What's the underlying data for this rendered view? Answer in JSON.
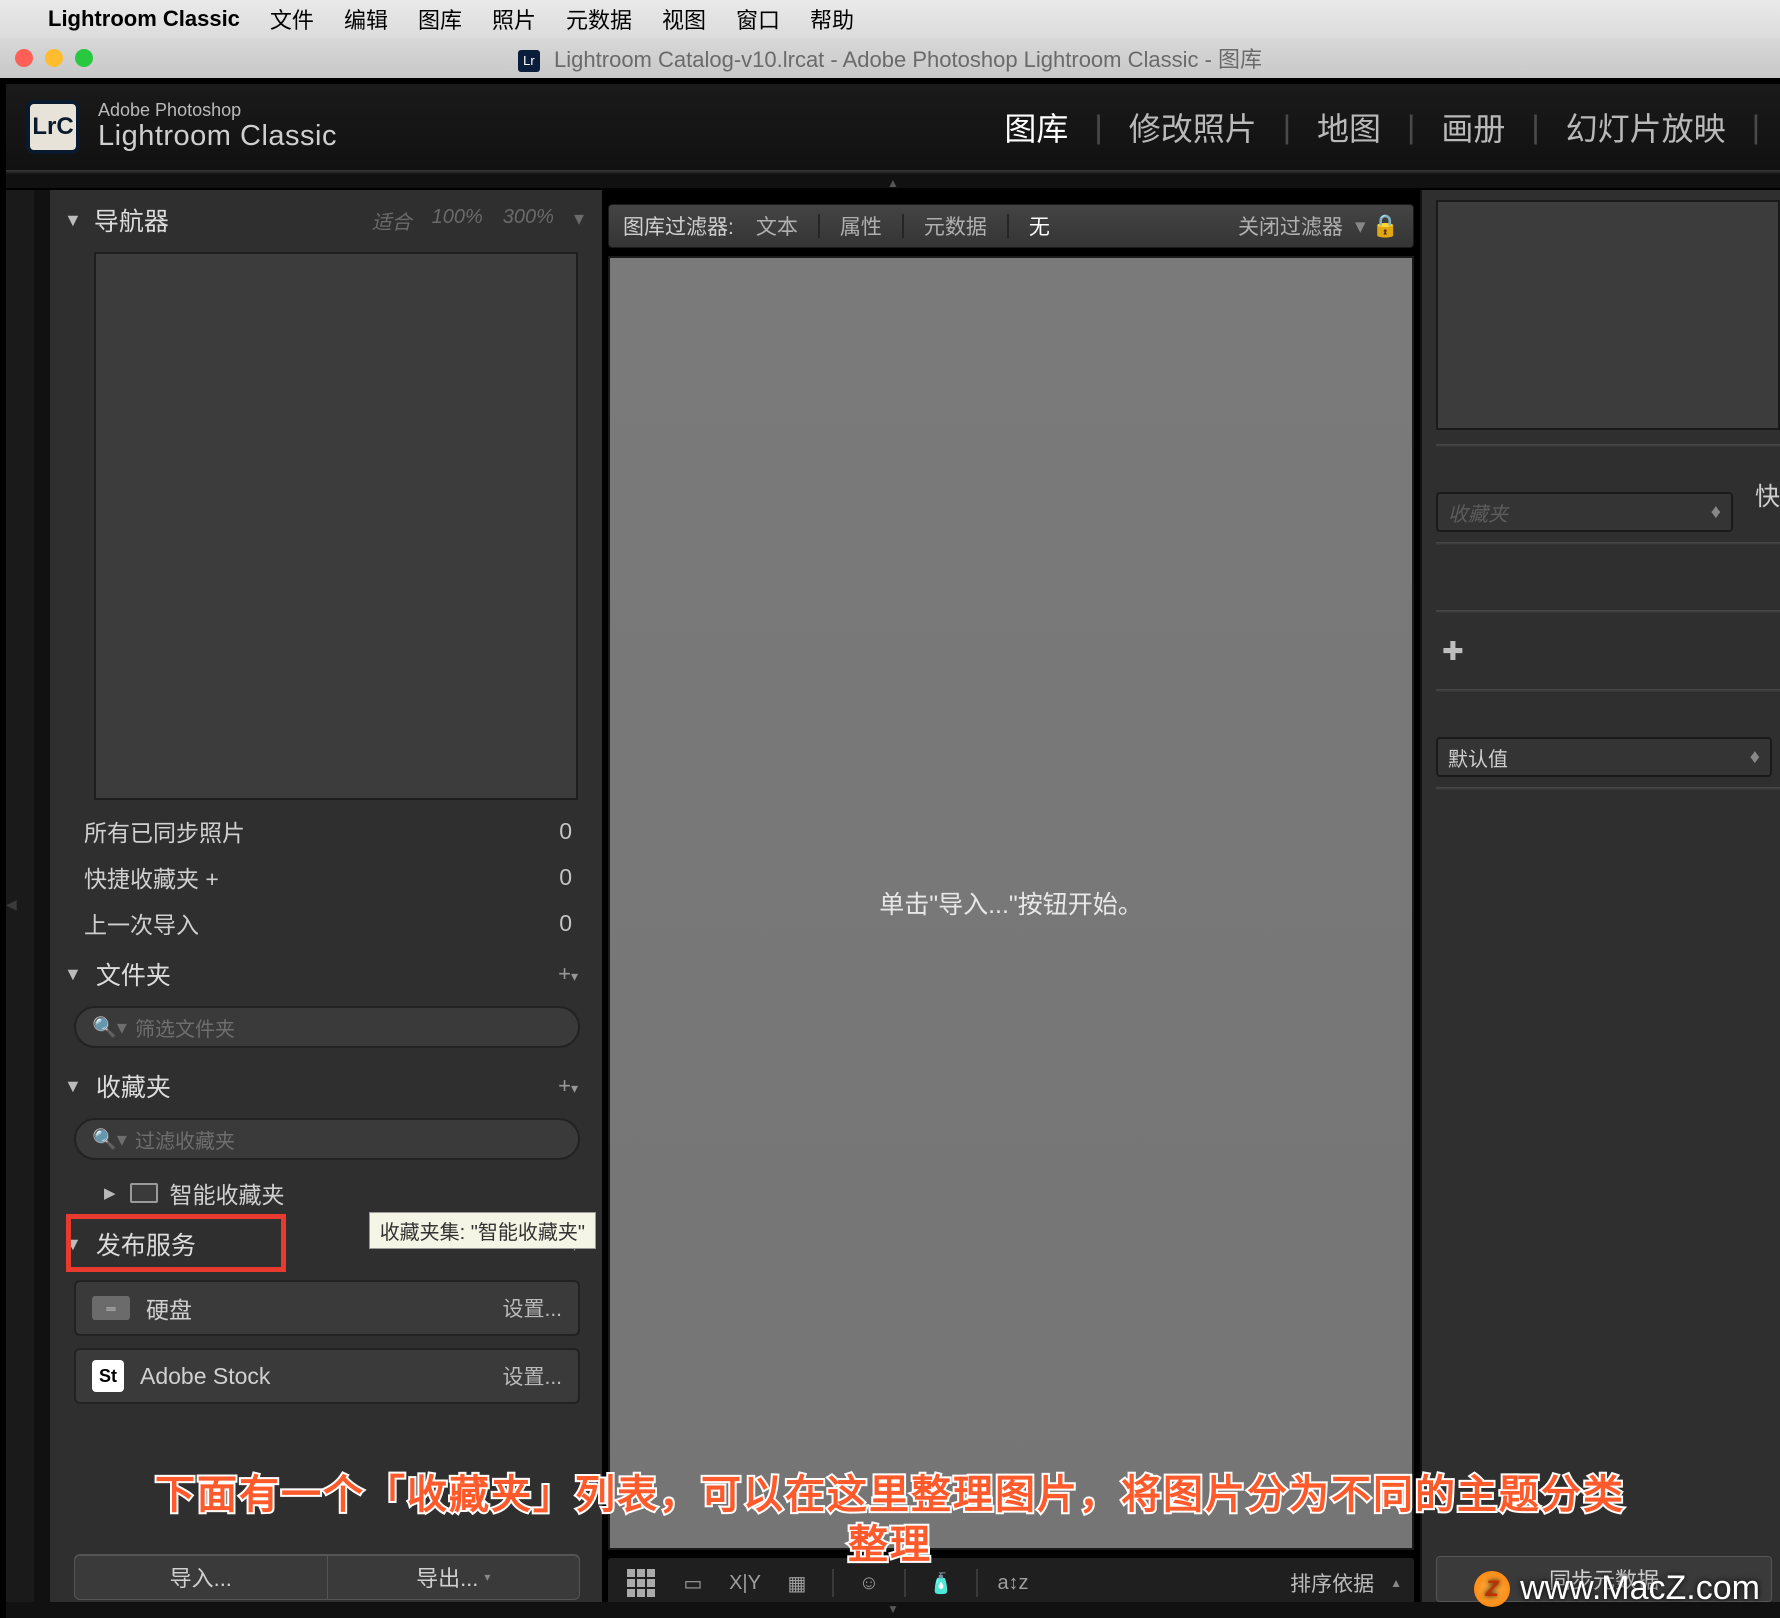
{
  "mac_menu": {
    "app_name": "Lightroom Classic",
    "items": [
      "文件",
      "编辑",
      "图库",
      "照片",
      "元数据",
      "视图",
      "窗口",
      "帮助"
    ]
  },
  "window": {
    "title": "Lightroom Catalog-v10.lrcat - Adobe Photoshop Lightroom Classic - 图库"
  },
  "header": {
    "brand_small": "Adobe Photoshop",
    "brand_large": "Lightroom Classic",
    "logo_text": "LrC",
    "modules": [
      "图库",
      "修改照片",
      "地图",
      "画册",
      "幻灯片放映"
    ],
    "active_module": "图库"
  },
  "left": {
    "navigator": {
      "title": "导航器",
      "zoom_levels": [
        "适合",
        "100%",
        "300%"
      ]
    },
    "catalog": {
      "items": [
        {
          "label": "所有已同步照片",
          "count": "0"
        },
        {
          "label": "快捷收藏夹 +",
          "count": "0"
        },
        {
          "label": "上一次导入",
          "count": "0"
        }
      ]
    },
    "folders": {
      "title": "文件夹",
      "search_placeholder": "筛选文件夹"
    },
    "collections": {
      "title": "收藏夹",
      "search_placeholder": "过滤收藏夹",
      "smart_label": "智能收藏夹",
      "tooltip": "收藏夹集: \"智能收藏夹\""
    },
    "publish": {
      "title": "发布服务",
      "rows": [
        {
          "label": "硬盘",
          "setup": "设置..."
        },
        {
          "label": "Adobe Stock",
          "setup": "设置..."
        }
      ]
    },
    "import_btn": "导入...",
    "export_btn": "导出..."
  },
  "filter_bar": {
    "label": "图库过滤器:",
    "items": [
      "文本",
      "属性",
      "元数据",
      "无"
    ],
    "active": "无",
    "close_label": "关闭过滤器"
  },
  "center": {
    "empty_hint": "单击\"导入...\"按钮开始。"
  },
  "toolbar": {
    "sort_label": "排序依据"
  },
  "right": {
    "combo_label": "收藏夹",
    "quick_label": "快",
    "default_label": "默认值",
    "sync_btn": "同步元数据"
  },
  "caption": {
    "line1": "下面有一个「收藏夹」列表，可以在这里整理图片，将图片分为不同的主题分类",
    "line2": "整理"
  },
  "watermark": "www.MacZ.com"
}
